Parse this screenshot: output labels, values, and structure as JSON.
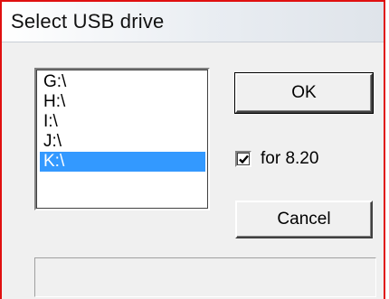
{
  "window": {
    "title": "Select USB drive"
  },
  "drives": [
    {
      "label": "G:\\",
      "selected": false
    },
    {
      "label": "H:\\",
      "selected": false
    },
    {
      "label": "I:\\",
      "selected": false
    },
    {
      "label": "J:\\",
      "selected": false
    },
    {
      "label": "K:\\",
      "selected": true
    }
  ],
  "buttons": {
    "ok_label": "OK",
    "cancel_label": "Cancel"
  },
  "option": {
    "label": "for 8.20",
    "checked": true
  },
  "status": {
    "text": ""
  },
  "colors": {
    "selection": "#3399ff",
    "frame": "#e01010"
  }
}
